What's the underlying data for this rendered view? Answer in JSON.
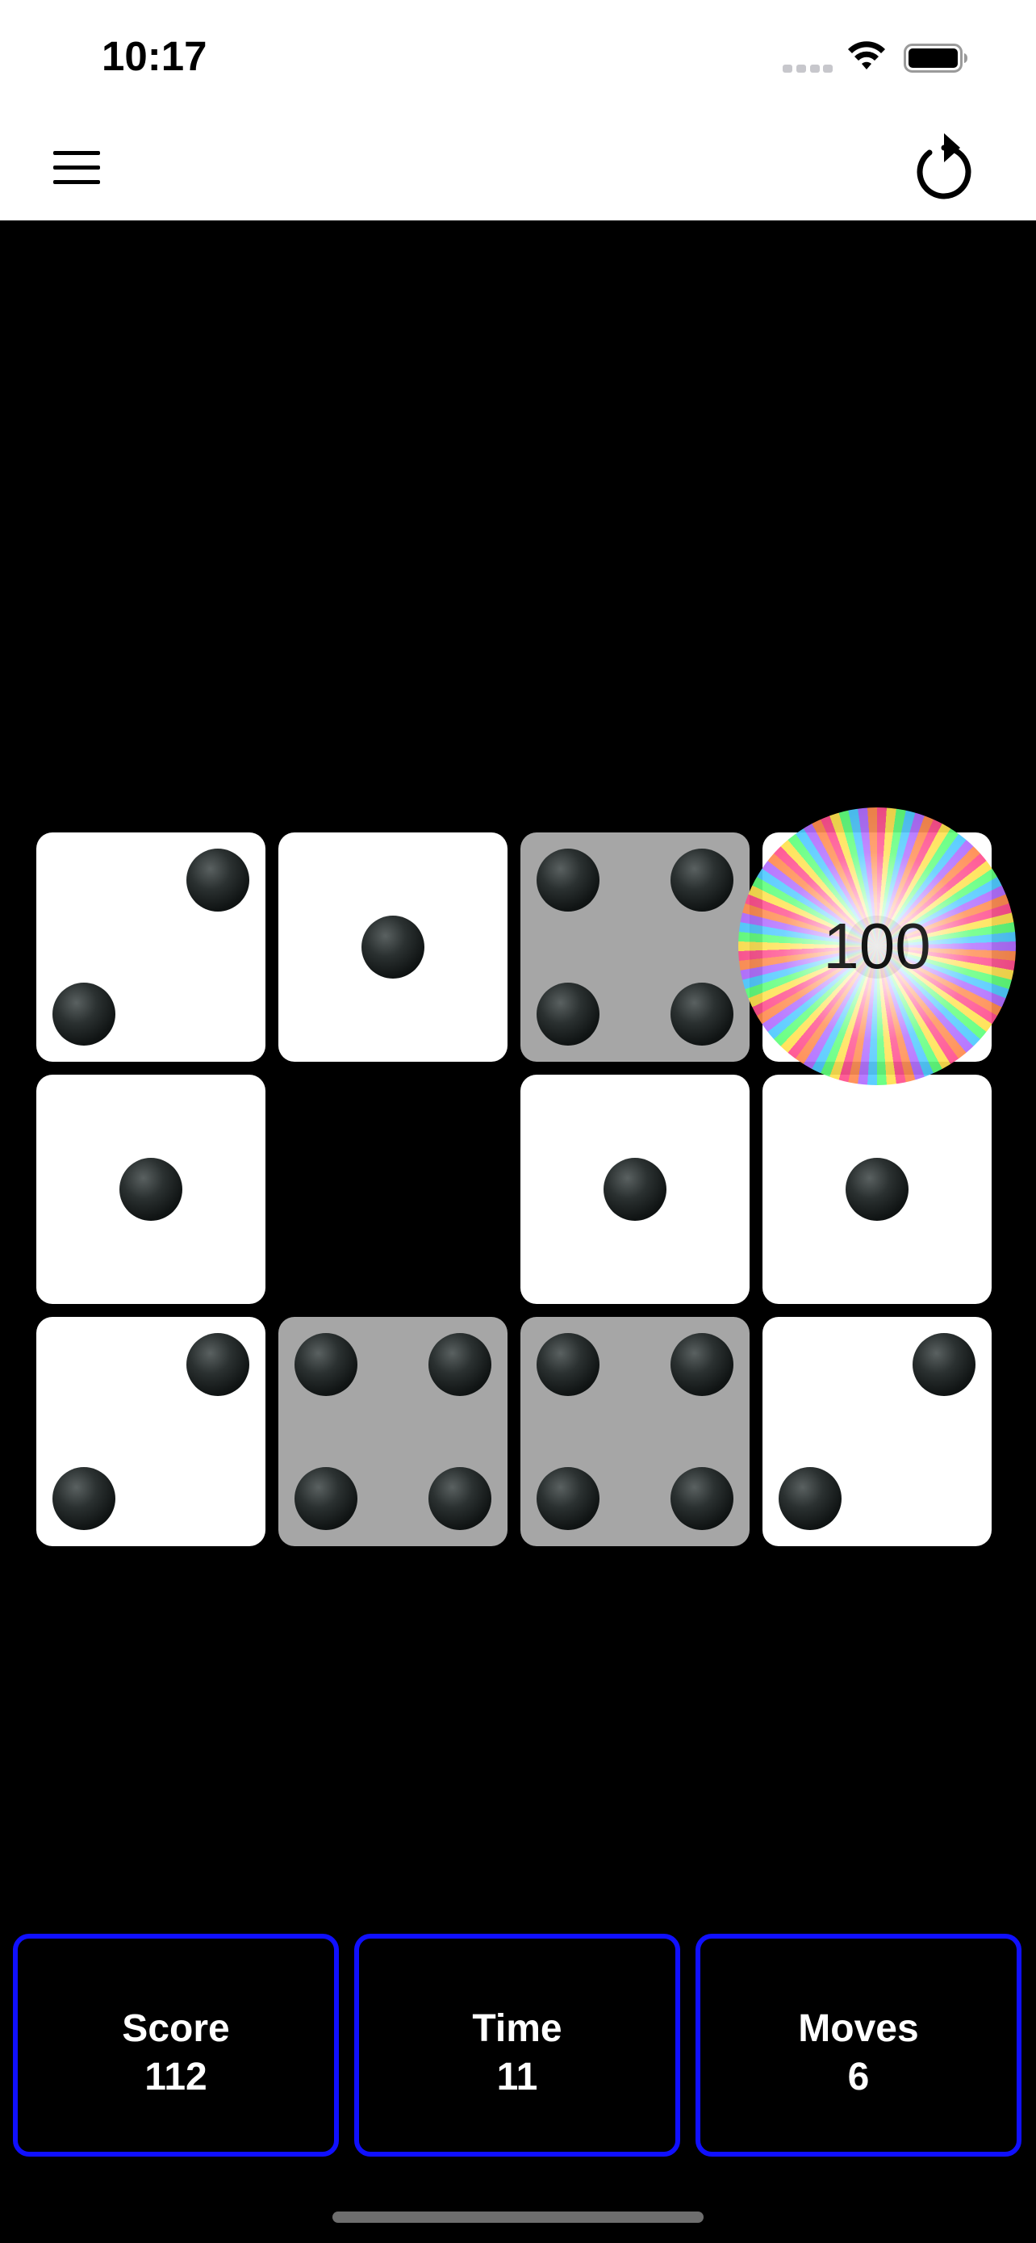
{
  "status_bar": {
    "time": "10:17",
    "wifi_icon": "wifi-icon",
    "battery_icon": "battery-icon",
    "signal_icon": "cellular-signal-icon"
  },
  "nav_bar": {
    "menu_icon": "menu-icon",
    "restart_icon": "restart-icon"
  },
  "board": {
    "rows": 3,
    "cols": 4,
    "tiles": [
      {
        "row": 0,
        "col": 0,
        "face": 2,
        "shade": "white"
      },
      {
        "row": 0,
        "col": 1,
        "face": 1,
        "shade": "white"
      },
      {
        "row": 0,
        "col": 2,
        "face": 4,
        "shade": "gray"
      },
      {
        "row": 0,
        "col": 3,
        "face": 1,
        "shade": "white"
      },
      {
        "row": 1,
        "col": 0,
        "face": 1,
        "shade": "white"
      },
      {
        "row": 1,
        "col": 1,
        "face": 0,
        "shade": "empty"
      },
      {
        "row": 1,
        "col": 2,
        "face": 1,
        "shade": "white"
      },
      {
        "row": 1,
        "col": 3,
        "face": 1,
        "shade": "white"
      },
      {
        "row": 2,
        "col": 0,
        "face": 2,
        "shade": "white"
      },
      {
        "row": 2,
        "col": 1,
        "face": 4,
        "shade": "gray"
      },
      {
        "row": 2,
        "col": 2,
        "face": 4,
        "shade": "gray"
      },
      {
        "row": 2,
        "col": 3,
        "face": 2,
        "shade": "white"
      }
    ],
    "bonus": {
      "text": "100"
    }
  },
  "stats": {
    "score": {
      "label": "Score",
      "value": "112"
    },
    "time": {
      "label": "Time",
      "value": "11"
    },
    "moves": {
      "label": "Moves",
      "value": "6"
    }
  },
  "colors": {
    "background": "#000000",
    "bar": "#ffffff",
    "tile_white": "#ffffff",
    "tile_gray": "#a6a6a6",
    "stat_border": "#1010ff",
    "stat_text": "#ffffff"
  }
}
